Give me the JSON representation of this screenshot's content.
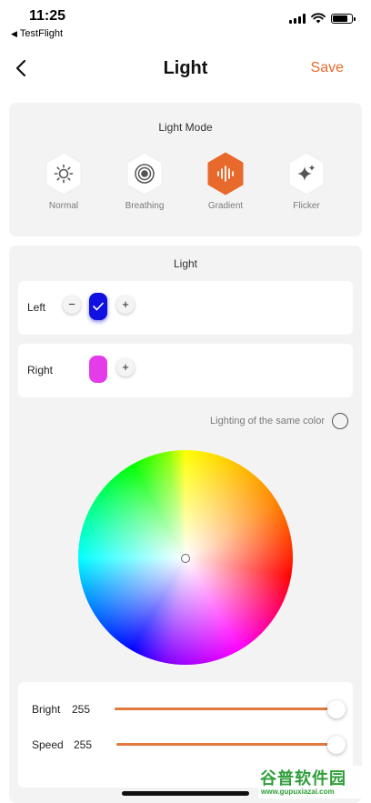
{
  "status_bar": {
    "time": "11:25",
    "back_app": "TestFlight"
  },
  "nav": {
    "title": "Light",
    "save_label": "Save"
  },
  "light_mode": {
    "title": "Light Mode",
    "modes": [
      {
        "label": "Normal",
        "icon": "sun-icon",
        "selected": false
      },
      {
        "label": "Breathing",
        "icon": "breathing-rings-icon",
        "selected": false
      },
      {
        "label": "Gradient",
        "icon": "sound-wave-icon",
        "selected": true
      },
      {
        "label": "Flicker",
        "icon": "sparkle-icon",
        "selected": false
      }
    ]
  },
  "light": {
    "title": "Light",
    "left": {
      "label": "Left",
      "minus": "−",
      "plus": "+",
      "color": "#1010e0",
      "selected": true
    },
    "right": {
      "label": "Right",
      "plus": "+",
      "color": "#e43ce8"
    },
    "same_color_label": "Lighting of the same color",
    "bright": {
      "label": "Bright",
      "value": "255"
    },
    "speed": {
      "label": "Speed",
      "value": "255"
    }
  },
  "colors": {
    "accent": "#e8692c",
    "selected_mode": "#e8692c",
    "card_bg": "#f3f3f3",
    "slider_track": "#e07a3e"
  },
  "watermark": {
    "text": "谷普软件园",
    "url": "www.gupuxiazai.com"
  }
}
